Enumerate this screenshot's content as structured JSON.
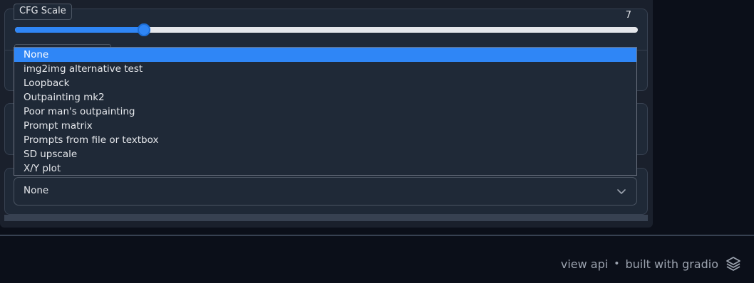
{
  "cfg": {
    "label": "CFG Scale",
    "value": "7",
    "min": 1,
    "max": 30,
    "current": 7
  },
  "script_dropdown": {
    "options": [
      "None",
      "img2img alternative test",
      "Loopback",
      "Outpainting mk2",
      "Poor man's outpainting",
      "Prompt matrix",
      "Prompts from file or textbox",
      "SD upscale",
      "X/Y plot"
    ],
    "highlighted_index": 0,
    "selected_value": "None"
  },
  "footer": {
    "view_api": "view api",
    "separator": "•",
    "built_with": "built with gradio"
  },
  "icons": {
    "chevron": "chevron-down-icon",
    "gradio": "gradio-logo-icon"
  },
  "colors": {
    "accent": "#2f86f6",
    "panel": "#1f2937",
    "background": "#0b0f19"
  }
}
